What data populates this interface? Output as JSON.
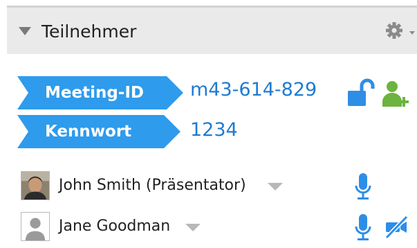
{
  "panel": {
    "title": "Teilnehmer"
  },
  "meeting": {
    "id_label": "Meeting-ID",
    "id_value": "m43-614-829",
    "password_label": "Kennwort",
    "password_value": "1234"
  },
  "participants": [
    {
      "name": "John Smith (Präsentator)",
      "avatar": "photo"
    },
    {
      "name": "Jane Goodman",
      "avatar": "placeholder-person-icon"
    }
  ],
  "icons": {
    "collapse": "triangle-down-icon",
    "settings": "gear-icon",
    "lock": "unlocked-padlock-icon",
    "add_user": "add-user-icon",
    "mic": "microphone-icon",
    "camera_off": "camera-off-icon",
    "dropdown": "chevron-down-icon"
  },
  "colors": {
    "accent_blue": "#2e9bec",
    "link_blue": "#1f7bd1",
    "green": "#6db33f",
    "header_bg": "#eaeaea"
  }
}
